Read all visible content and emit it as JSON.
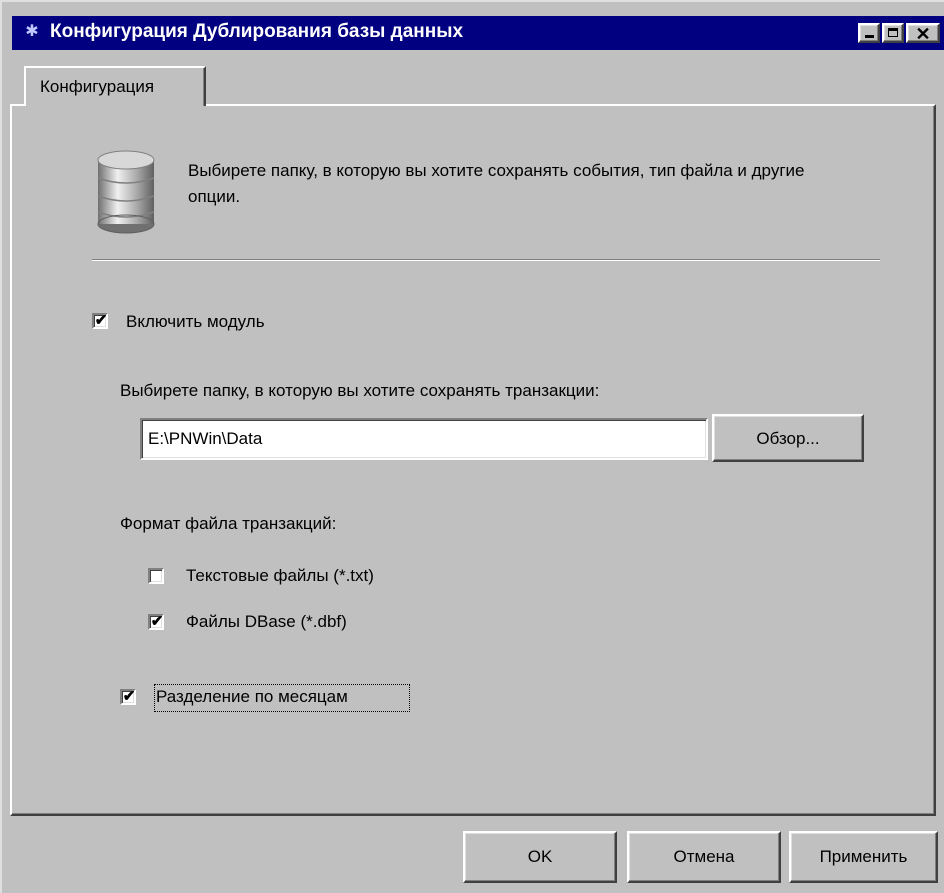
{
  "window": {
    "title": "Конфигурация Дублирования базы данных",
    "title_icon": "app-icon",
    "controls": {
      "minimize": "_",
      "maximize": "□",
      "close": "✕"
    }
  },
  "tabs": [
    {
      "label": "Конфигурация",
      "active": true
    }
  ],
  "header": {
    "icon": "database-icon",
    "text": "Выбирете папку, в которую вы хотите сохранять события, тип файла и другие опции."
  },
  "enable_module": {
    "label": "Включить модуль",
    "checked": true
  },
  "folder": {
    "label": "Выбирете папку, в которую вы хотите сохранять транзакции:",
    "value": "E:\\PNWin\\Data",
    "browse_label": "Обзор..."
  },
  "format": {
    "label": "Формат файла транзакций:",
    "options": [
      {
        "label": "Текстовые файлы (*.txt)",
        "checked": false
      },
      {
        "label": "Файлы DBase (*.dbf)",
        "checked": true
      }
    ]
  },
  "split_by_month": {
    "label": "Разделение по месяцам",
    "checked": true
  },
  "buttons": {
    "ok": "OK",
    "cancel": "Отмена",
    "apply": "Применить"
  },
  "colors": {
    "titlebar": "#000080",
    "face": "#c0c0c0",
    "highlight": "#ffffff",
    "shadow": "#808080"
  }
}
